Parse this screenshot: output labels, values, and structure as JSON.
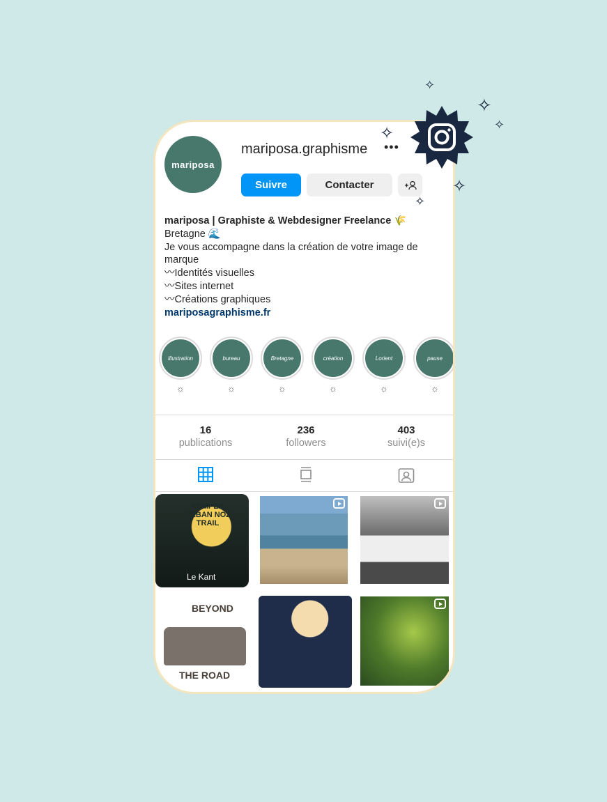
{
  "profile": {
    "username": "mariposa.graphisme",
    "avatar_text": "mariposa",
    "more": "•••",
    "follow_label": "Suivre",
    "contact_label": "Contacter",
    "add_user_icon": "+person"
  },
  "bio": {
    "name": "mariposa | Graphiste & Webdesigner Freelance 🌾",
    "lines": [
      "Bretagne 🌊",
      "Je vous accompagne dans la création de votre image de marque",
      "〰Identités visuelles",
      "〰Sites internet",
      "〰Créations graphiques"
    ],
    "link": "mariposagraphisme.fr"
  },
  "highlights": [
    {
      "label": "illustration",
      "sub": "☼"
    },
    {
      "label": "bureau",
      "sub": "☼"
    },
    {
      "label": "Bretagne",
      "sub": "☼"
    },
    {
      "label": "création",
      "sub": "☼"
    },
    {
      "label": "Lorient",
      "sub": "☼"
    },
    {
      "label": "pause",
      "sub": "☼"
    }
  ],
  "stats": [
    {
      "n": "16",
      "l": "publications"
    },
    {
      "n": "236",
      "l": "followers"
    },
    {
      "n": "403",
      "l": "suivi(e)s"
    }
  ],
  "tabs": [
    {
      "icon": "grid-icon",
      "active": true
    },
    {
      "icon": "reels-icon"
    },
    {
      "icon": "tagged-icon"
    }
  ],
  "posts": [
    {
      "text": "KEMPER URBAN NOZ TRAIL",
      "sub": "Le Kant"
    },
    {
      "reel": true
    },
    {
      "reel": true
    },
    {
      "text": "BEYOND",
      "sub": "THE ROAD"
    },
    {},
    {
      "reel": true
    }
  ],
  "colors": {
    "background": "#cfe9e8",
    "accent": "#0095f6",
    "brand": "#48786c",
    "badge": "#1a2740"
  }
}
